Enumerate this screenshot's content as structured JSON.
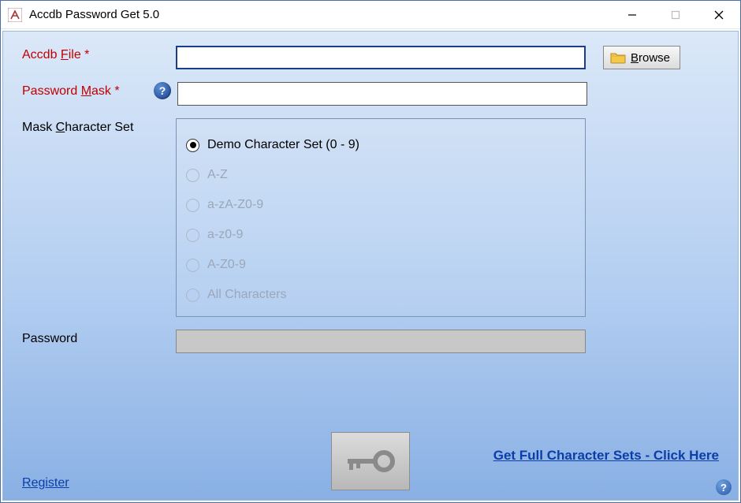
{
  "window": {
    "title": "Accdb Password Get 5.0"
  },
  "labels": {
    "accdb_file_prefix": "Accdb ",
    "accdb_file_u": "F",
    "accdb_file_suffix": "ile *",
    "password_mask_prefix": "Password ",
    "password_mask_u": "M",
    "password_mask_suffix": "ask *",
    "charset_prefix": "Mask ",
    "charset_u": "C",
    "charset_suffix": "haracter Set",
    "password": "Password"
  },
  "fields": {
    "accdb_file": "",
    "password_mask": "",
    "password": ""
  },
  "browse": {
    "u": "B",
    "rest": "rowse"
  },
  "charset_options": [
    {
      "label": "Demo Character Set (0 - 9)",
      "selected": true,
      "enabled": true
    },
    {
      "label": "A-Z",
      "selected": false,
      "enabled": false
    },
    {
      "label": "a-zA-Z0-9",
      "selected": false,
      "enabled": false
    },
    {
      "label": "a-z0-9",
      "selected": false,
      "enabled": false
    },
    {
      "label": "A-Z0-9",
      "selected": false,
      "enabled": false
    },
    {
      "label": "All Characters",
      "selected": false,
      "enabled": false
    }
  ],
  "links": {
    "register_u": "R",
    "register_rest": "egister",
    "promo": "Get Full Character Sets - Click Here"
  },
  "help_glyph": "?"
}
